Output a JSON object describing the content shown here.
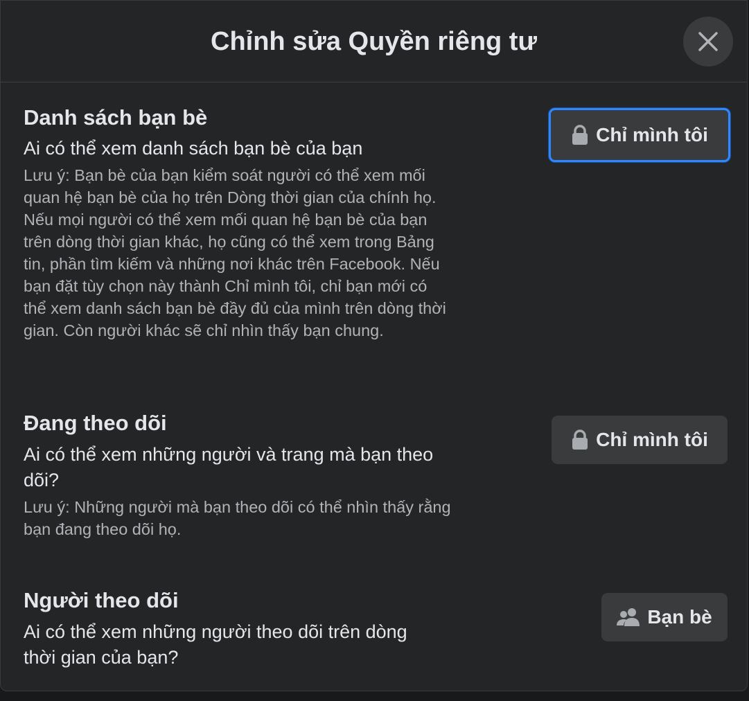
{
  "dialog": {
    "title": "Chỉnh sửa Quyền riêng tư",
    "close_icon": "close-icon"
  },
  "sections": [
    {
      "title": "Danh sách bạn bè",
      "question": "Ai có thể xem danh sách bạn bè của bạn",
      "note": "Lưu ý: Bạn bè của bạn kiểm soát người có thể xem mối quan hệ bạn bè của họ trên Dòng thời gian của chính họ. Nếu mọi người có thể xem mối quan hệ bạn bè của bạn trên dòng thời gian khác, họ cũng có thể xem trong Bảng tin, phần tìm kiếm và những nơi khác trên Facebook. Nếu bạn đặt tùy chọn này thành Chỉ mình tôi, chỉ bạn mới có thể xem danh sách bạn bè đầy đủ của mình trên dòng thời gian. Còn người khác sẽ chỉ nhìn thấy bạn chung.",
      "button_label": "Chỉ mình tôi",
      "button_icon": "lock-icon"
    },
    {
      "title": "Đang theo dõi",
      "question": "Ai có thể xem những người và trang mà bạn theo dõi?",
      "note": "Lưu ý: Những người mà bạn theo dõi có thể nhìn thấy rằng bạn đang theo dõi họ.",
      "button_label": "Chỉ mình tôi",
      "button_icon": "lock-icon"
    },
    {
      "title": "Người theo dõi",
      "question": "Ai có thể xem những người theo dõi trên dòng thời gian của bạn?",
      "button_label": "Bạn bè",
      "button_icon": "friends-icon"
    }
  ],
  "colors": {
    "background": "#242526",
    "button": "#3a3b3c",
    "focus_ring": "#2d88ff",
    "primary_text": "#e4e6eb",
    "secondary_text": "#b0b3b8"
  }
}
